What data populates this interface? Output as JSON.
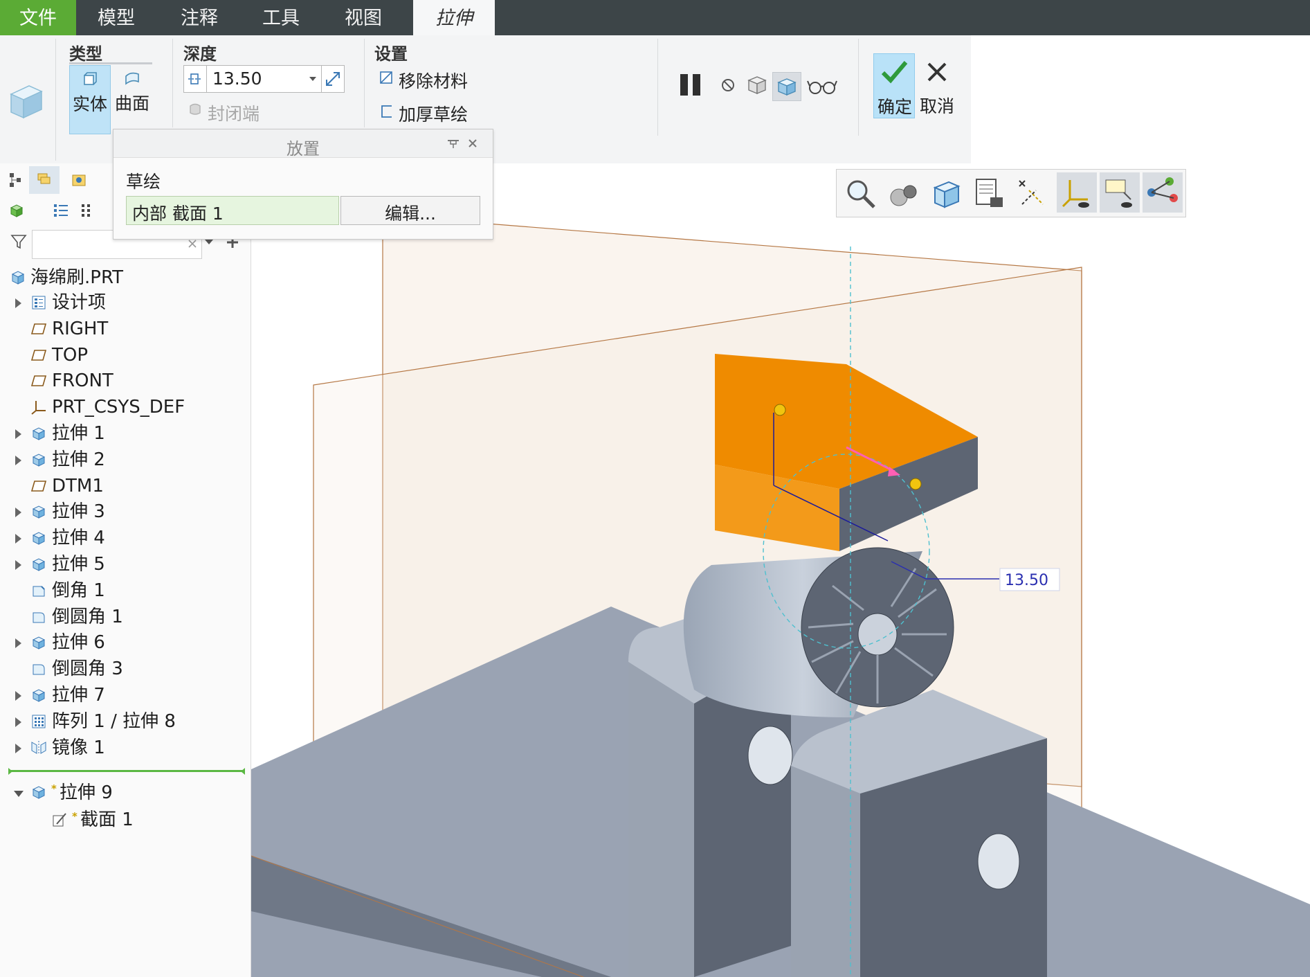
{
  "menu": {
    "file": "文件",
    "model": "模型",
    "annotate": "注释",
    "tools": "工具",
    "view": "视图",
    "extrude": "拉伸"
  },
  "ribbon": {
    "type_group": "类型",
    "solid": "实体",
    "surface": "曲面",
    "depth_group": "深度",
    "depth_value": "13.50",
    "capped_ends": "封闭端",
    "settings_group": "设置",
    "remove_material": "移除材料",
    "thicken_sketch": "加厚草绘",
    "ok": "确定",
    "cancel": "取消"
  },
  "placement": {
    "title": "放置",
    "sketch_label": "草绘",
    "sketch_value": "内部 截面 1",
    "edit_button": "编辑..."
  },
  "tree": {
    "root": "海绵刷.PRT",
    "items": [
      {
        "label": "设计项",
        "icon": "design-items-icon",
        "expandable": true
      },
      {
        "label": "RIGHT",
        "icon": "datum-plane-icon",
        "expandable": false
      },
      {
        "label": "TOP",
        "icon": "datum-plane-icon",
        "expandable": false
      },
      {
        "label": "FRONT",
        "icon": "datum-plane-icon",
        "expandable": false
      },
      {
        "label": "PRT_CSYS_DEF",
        "icon": "csys-icon",
        "expandable": false
      },
      {
        "label": "拉伸 1",
        "icon": "extrude-icon",
        "expandable": true
      },
      {
        "label": "拉伸 2",
        "icon": "extrude-icon",
        "expandable": true
      },
      {
        "label": "DTM1",
        "icon": "datum-plane-icon",
        "expandable": false
      },
      {
        "label": "拉伸 3",
        "icon": "extrude-icon",
        "expandable": true
      },
      {
        "label": "拉伸 4",
        "icon": "extrude-icon",
        "expandable": true
      },
      {
        "label": "拉伸 5",
        "icon": "extrude-icon",
        "expandable": true
      },
      {
        "label": "倒角 1",
        "icon": "chamfer-icon",
        "expandable": false
      },
      {
        "label": "倒圆角 1",
        "icon": "round-icon",
        "expandable": false
      },
      {
        "label": "拉伸 6",
        "icon": "extrude-icon",
        "expandable": true
      },
      {
        "label": "倒圆角 3",
        "icon": "round-icon",
        "expandable": false
      },
      {
        "label": "拉伸 7",
        "icon": "extrude-icon",
        "expandable": true
      },
      {
        "label": "阵列 1 / 拉伸 8",
        "icon": "pattern-icon",
        "expandable": true
      },
      {
        "label": "镜像 1",
        "icon": "mirror-icon",
        "expandable": true
      }
    ],
    "active_feature": "拉伸 9",
    "active_child": "截面 1",
    "new_marker": "*"
  },
  "viewport": {
    "dimension_label": "13.50"
  },
  "colors": {
    "menubar": "#3d4548",
    "file_tab": "#5bab35",
    "selected_face": "#ef8b00",
    "part_body": "#8d98a8",
    "ok_button": "#7dc8f0"
  }
}
